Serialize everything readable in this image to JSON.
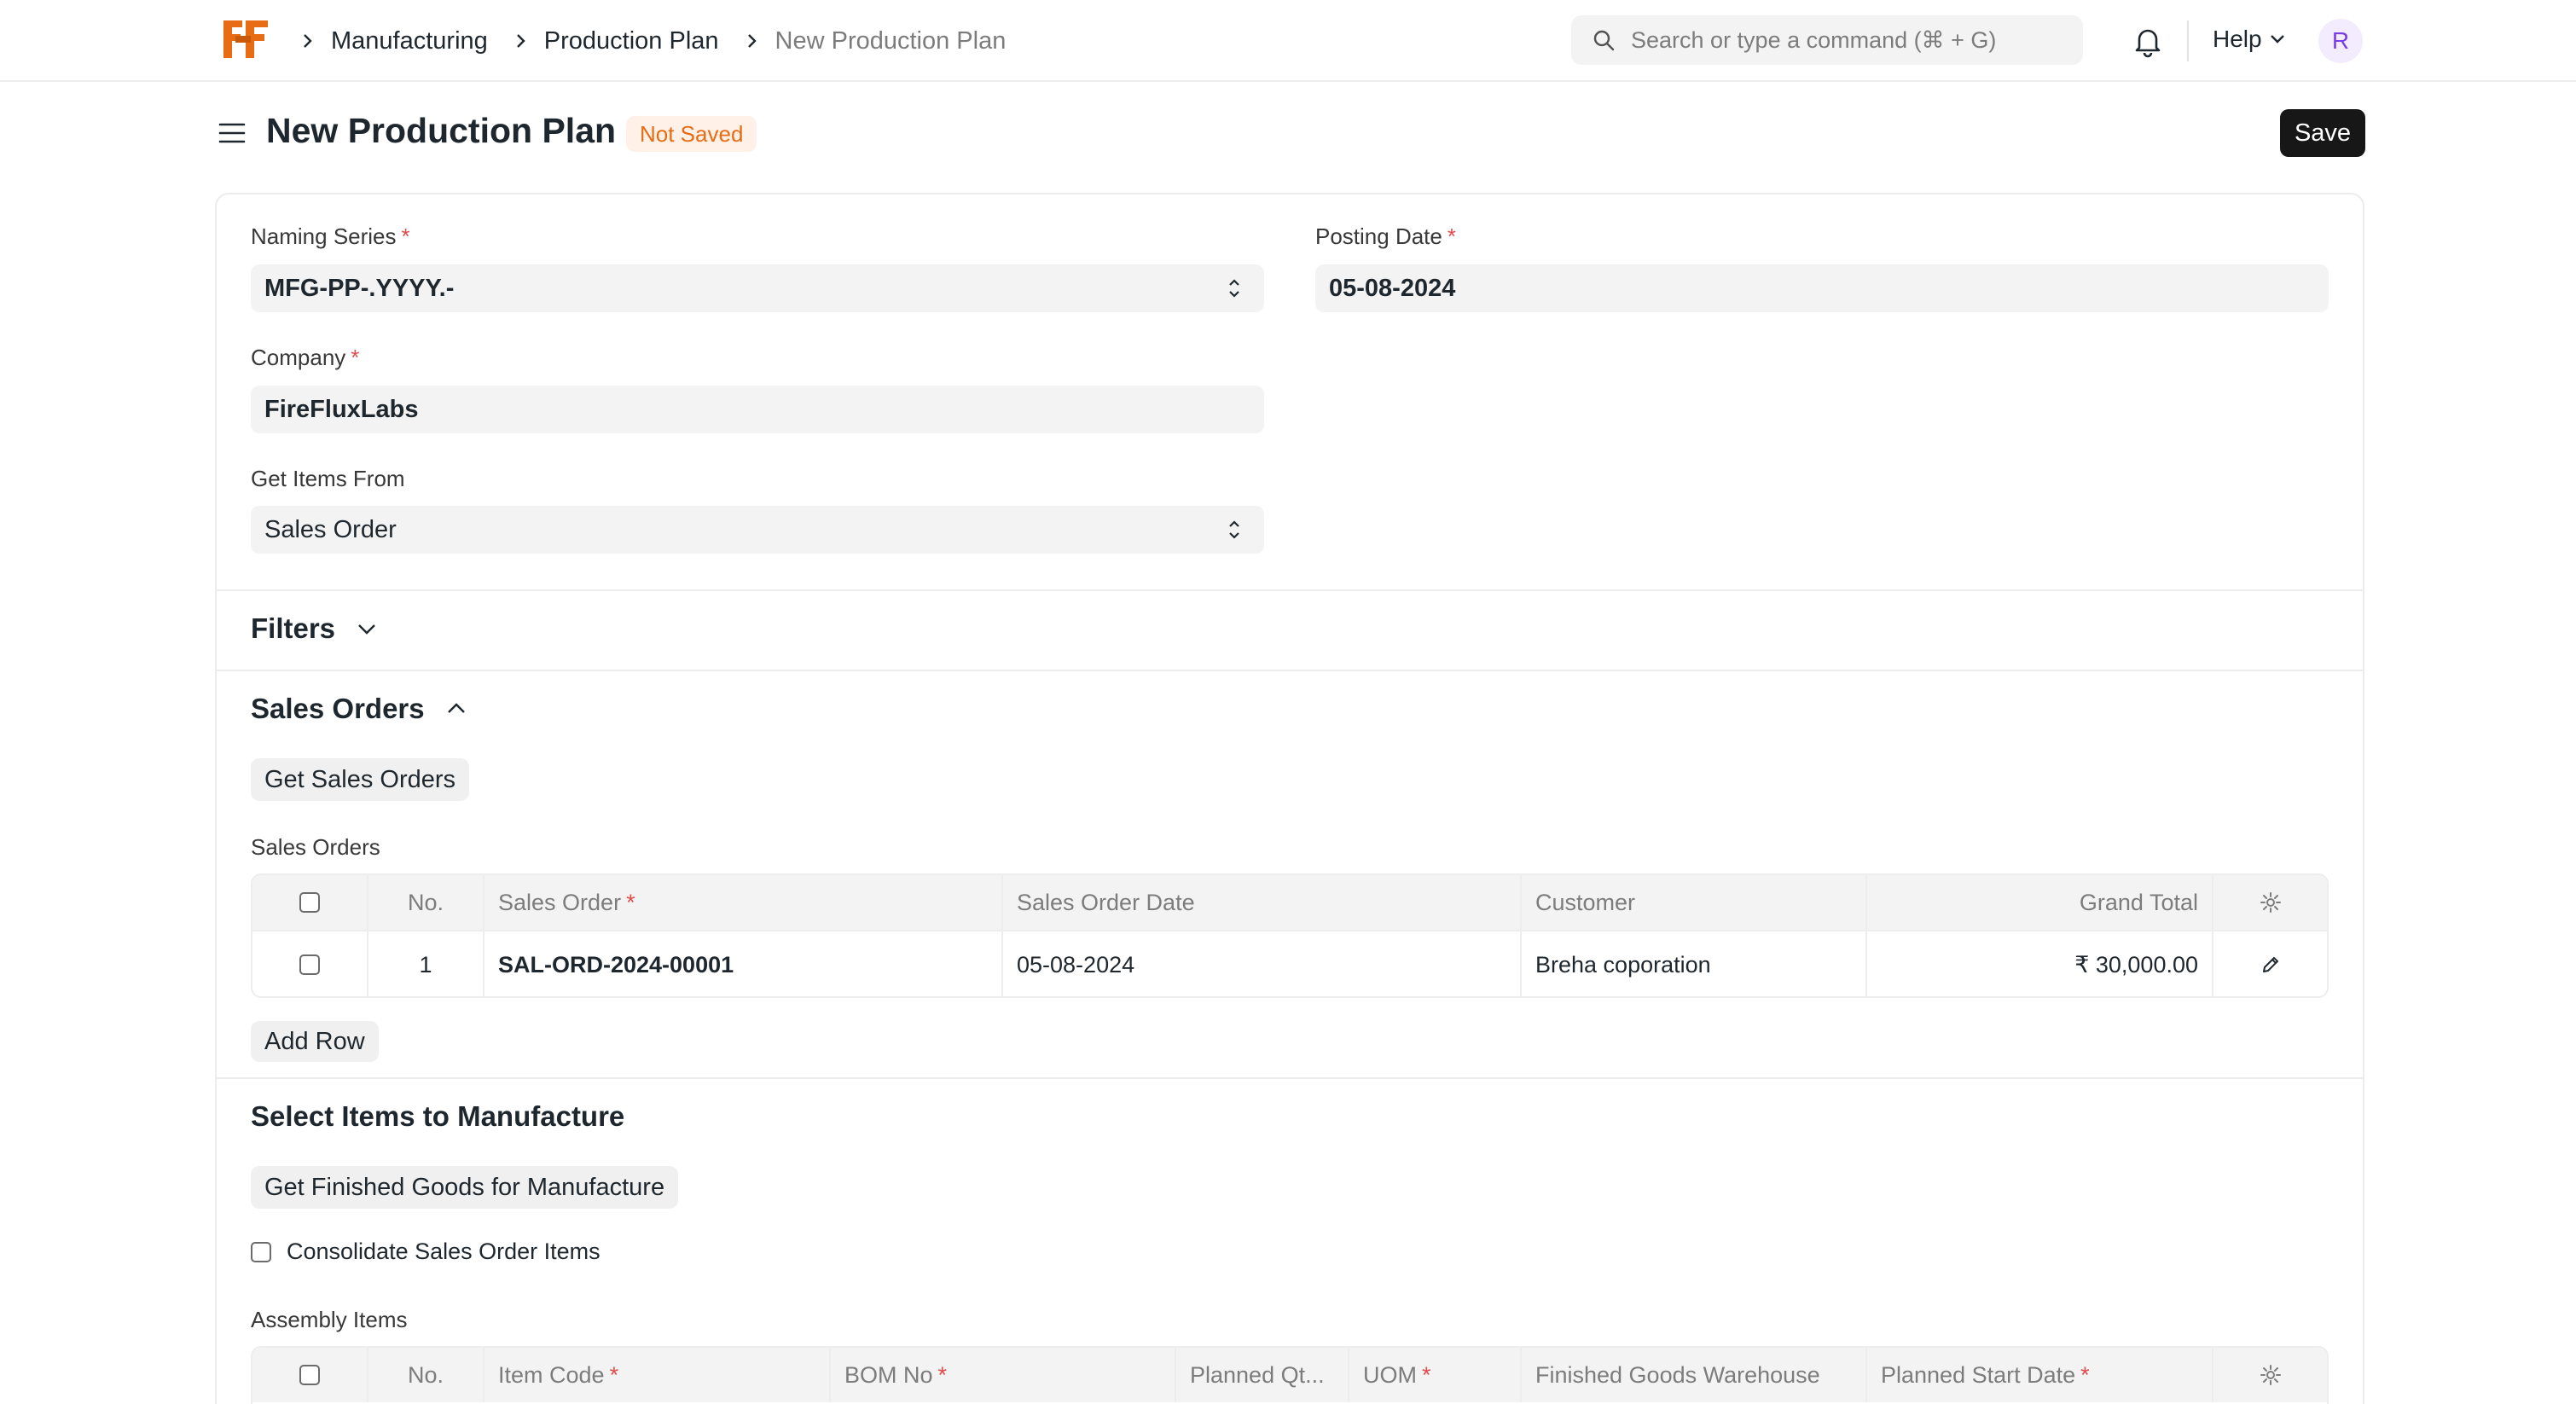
{
  "navbar": {
    "breadcrumbs": [
      "Manufacturing",
      "Production Plan",
      "New Production Plan"
    ],
    "search_placeholder": "Search or type a command (⌘ + G)",
    "help_label": "Help",
    "avatar_initial": "R"
  },
  "page": {
    "title": "New Production Plan",
    "status_badge": "Not Saved",
    "save_label": "Save"
  },
  "form": {
    "naming_series": {
      "label": "Naming Series",
      "value": "MFG-PP-.YYYY.-"
    },
    "posting_date": {
      "label": "Posting Date",
      "value": "05-08-2024"
    },
    "company": {
      "label": "Company",
      "value": "FireFluxLabs"
    },
    "get_items_from": {
      "label": "Get Items From",
      "value": "Sales Order"
    }
  },
  "filters": {
    "title": "Filters"
  },
  "sales_orders_section": {
    "title": "Sales Orders",
    "get_button": "Get Sales Orders",
    "table_label": "Sales Orders",
    "columns": [
      "No.",
      "Sales Order",
      "Sales Order Date",
      "Customer",
      "Grand Total"
    ],
    "rows": [
      {
        "no": "1",
        "sales_order": "SAL-ORD-2024-00001",
        "date": "05-08-2024",
        "customer": "Breha coporation",
        "grand_total": "₹ 30,000.00"
      }
    ],
    "add_row": "Add Row"
  },
  "manufacture_section": {
    "title": "Select Items to Manufacture",
    "get_button": "Get Finished Goods for Manufacture",
    "consolidate_label": "Consolidate Sales Order Items",
    "table_label": "Assembly Items",
    "columns": [
      "No.",
      "Item Code",
      "BOM No",
      "Planned Qt...",
      "UOM",
      "Finished Goods Warehouse",
      "Planned Start Date"
    ]
  },
  "colors": {
    "accent_orange": "#e86c13",
    "required_red": "#e24c4c",
    "primary_dark": "#171717"
  }
}
